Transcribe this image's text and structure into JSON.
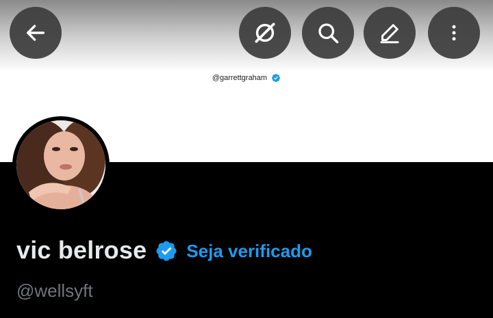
{
  "banner": {
    "handle": "@garrettgraham"
  },
  "profile": {
    "display_name": "vic belrose",
    "get_verified_label": "Seja verificado",
    "username": "@wellsyft"
  },
  "colors": {
    "accent": "#1d9bf0",
    "background": "#000000",
    "text_primary": "#e7e9ea",
    "text_secondary": "#71767b"
  },
  "icons": {
    "back": "arrow-left-icon",
    "grok": "grok-icon",
    "search": "search-icon",
    "edit": "edit-icon",
    "more": "more-vertical-icon"
  }
}
